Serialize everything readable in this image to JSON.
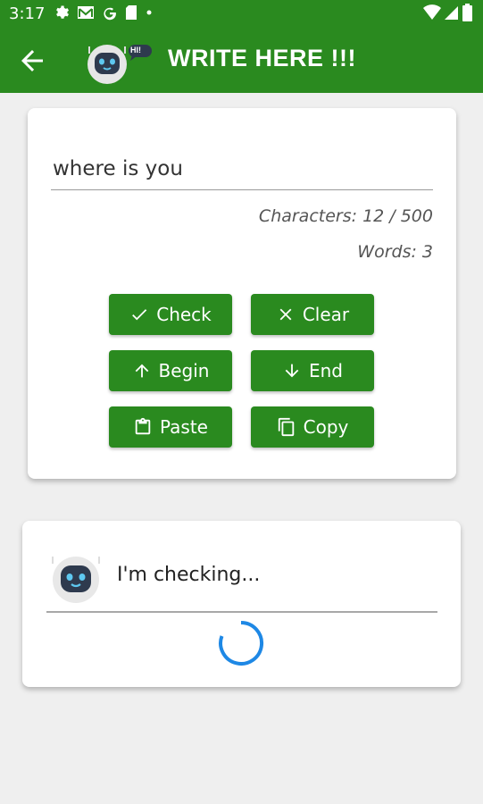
{
  "status_bar": {
    "time": "3:17",
    "icons_left": [
      "gear-icon",
      "mail-icon",
      "google-icon",
      "sd-card-icon",
      "dot-icon"
    ],
    "icons_right": [
      "wifi-icon",
      "signal-icon",
      "battery-icon"
    ]
  },
  "app_bar": {
    "title": "WRITE HERE !!!",
    "logo_bubble": "HI!",
    "back_icon": "arrow-left-icon",
    "color": "#2a8a1f"
  },
  "editor": {
    "input_value": "where is you",
    "characters_label": "Characters: 12 / 500",
    "words_label": "Words: 3"
  },
  "buttons": {
    "check": {
      "label": "Check",
      "icon": "check-icon"
    },
    "clear": {
      "label": "Clear",
      "icon": "close-icon"
    },
    "begin": {
      "label": "Begin",
      "icon": "arrow-up-icon"
    },
    "end": {
      "label": "End",
      "icon": "arrow-down-icon"
    },
    "paste": {
      "label": "Paste",
      "icon": "clipboard-icon"
    },
    "copy": {
      "label": "Copy",
      "icon": "copy-icon"
    }
  },
  "result": {
    "status_text": "I'm checking...",
    "spinner_color": "#1e88e5"
  }
}
